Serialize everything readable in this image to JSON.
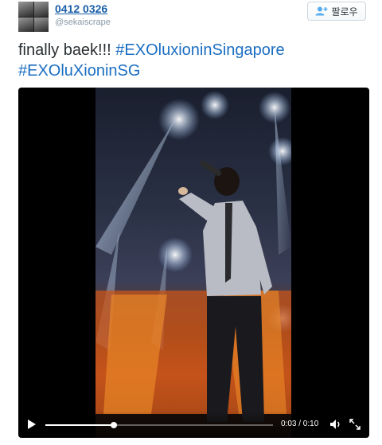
{
  "user": {
    "display_name": "0412 0326",
    "handle": "@sekaiscrape",
    "avatar_icon": "avatar-grid-photo"
  },
  "follow_button": {
    "label": "팔로우",
    "icon": "add-user-icon"
  },
  "tweet": {
    "text": "finally baek!!! ",
    "hashtags": [
      "#EXOluxioninSingapore",
      "#EXOluXioninSG"
    ]
  },
  "video": {
    "time_display": "0:03 / 0:10",
    "progress": 0.3,
    "play_icon": "play-icon",
    "volume_icon": "volume-icon",
    "fullscreen_icon": "fullscreen-icon"
  },
  "colors": {
    "link": "#1b6ec2",
    "name": "#1b5fa8",
    "muted": "#8899a6"
  }
}
